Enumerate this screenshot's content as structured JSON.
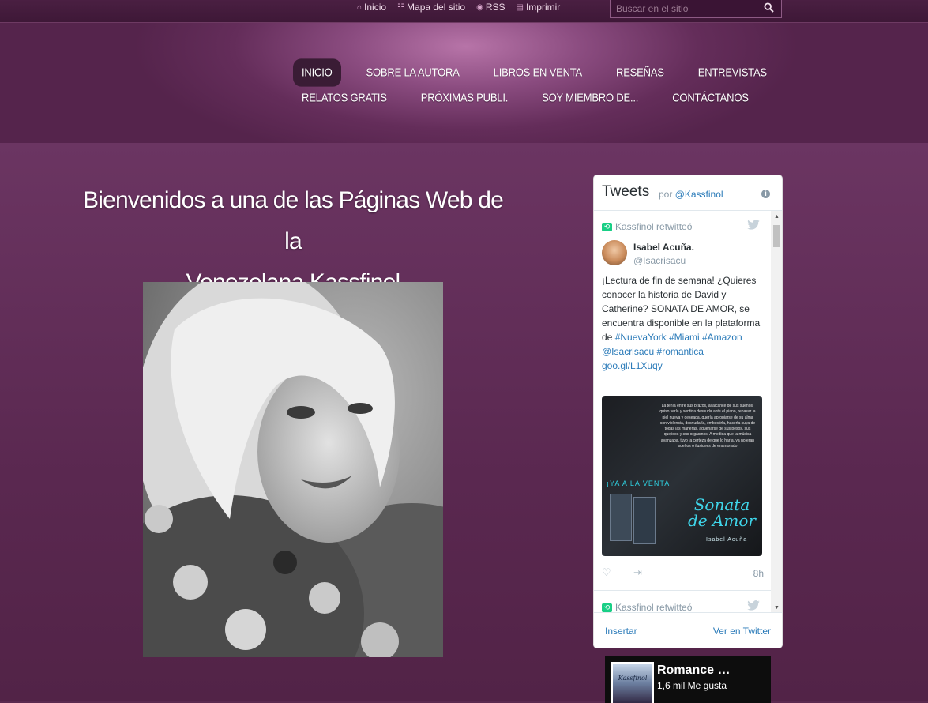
{
  "topbar": {
    "links": [
      {
        "label": "Inicio",
        "icon": "home-icon"
      },
      {
        "label": "Mapa del sitio",
        "icon": "sitemap-icon"
      },
      {
        "label": "RSS",
        "icon": "rss-icon"
      },
      {
        "label": "Imprimir",
        "icon": "print-icon"
      }
    ],
    "search_placeholder": "Buscar en el sitio"
  },
  "nav": {
    "row1": [
      "INICIO",
      "SOBRE LA AUTORA",
      "LIBROS EN VENTA",
      "RESEÑAS",
      "ENTREVISTAS"
    ],
    "row2": [
      "RELATOS GRATIS",
      "PRÓXIMAS PUBLI.",
      "SOY MIEMBRO DE...",
      "CONTÁCTANOS"
    ]
  },
  "main": {
    "title_line1": "Bienvenidos a una de las Páginas Web de la",
    "title_line2": "Venezolana Kassfinol"
  },
  "twitter": {
    "title": "Tweets",
    "by_prefix": "por",
    "by_handle": "@Kassfinol",
    "retweet_label": "Kassfinol retwitteó",
    "user_name": "Isabel Acuña.",
    "user_handle": "@Isacrisacu",
    "tweet_text": "¡Lectura de fin de semana! ¿Quieres conocer la historia de David y Catherine? SONATA DE AMOR, se encuentra disponible en la plataforma de",
    "hashtags": [
      "#NuevaYork",
      "#Miami",
      "#Amazon",
      "@Isacrisacu",
      "#romantica"
    ],
    "link": "goo.gl/L1Xuqy",
    "image_text": "La tenía entre sus brazos, al alcance de sus sueños, quiso verla y sentirla desnuda ante el piano, repasar la piel nueva y deseada, quería apropiarse de su alma con violencia, desnudarla, embestirla, hacerla suya de todas las maneras, adueñarse de sus besos, sus quejidos y sus orgasmos. A medida que la música avanzaba, tuvo la certeza de que lo haría, ya no eran sueños o ilusiones de enamorado",
    "image_banner": "¡YA A LA VENTA!",
    "image_book_title": "Sonata de Amor",
    "image_author": "Isabel Acuña",
    "time": "8h",
    "footer_left": "Insertar",
    "footer_right": "Ver en Twitter"
  },
  "facebook": {
    "page_name": "Romance …",
    "likes": "1,6 mil Me gusta",
    "thumb_text": "Kassfinol"
  },
  "colors": {
    "accent_link": "#2b7bb9",
    "retweet_green": "#19cf86",
    "nav_active": "#3a1c35"
  }
}
